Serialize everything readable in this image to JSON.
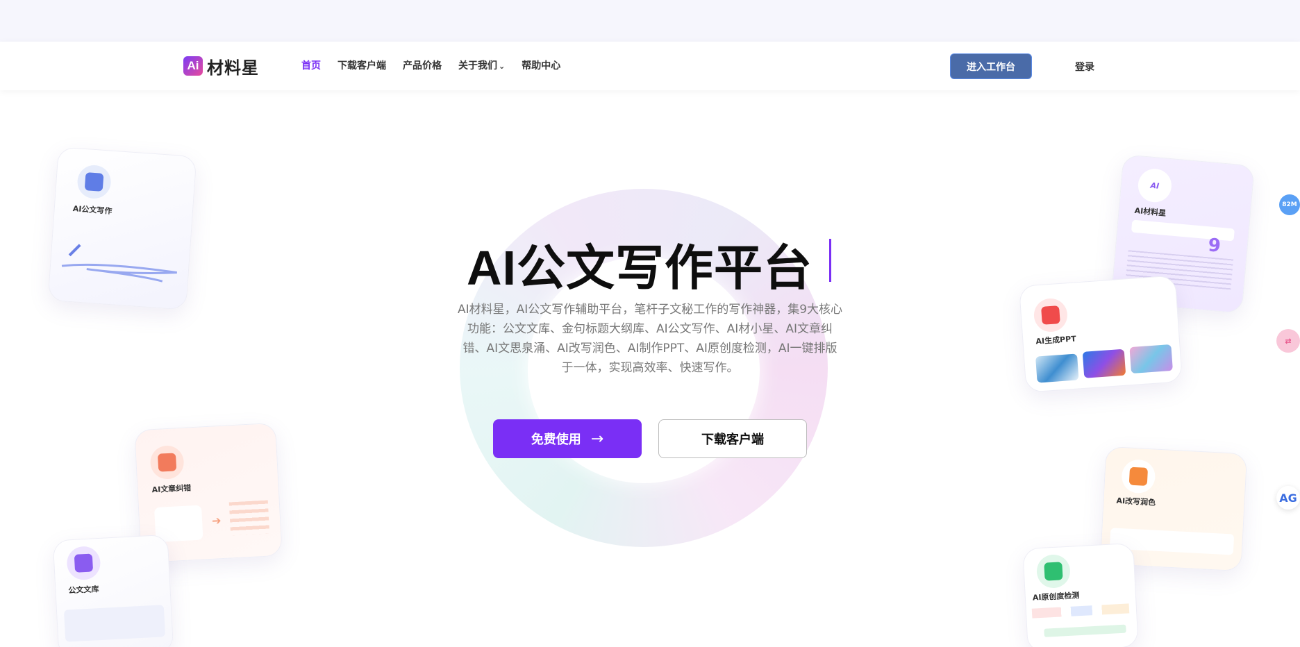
{
  "brand": {
    "logo_mark": "Ai",
    "name": "材料星"
  },
  "nav": {
    "items": [
      {
        "label": "首页",
        "active": true
      },
      {
        "label": "下载客户端"
      },
      {
        "label": "产品价格"
      },
      {
        "label": "关于我们",
        "has_dropdown": true
      },
      {
        "label": "帮助中心"
      }
    ],
    "workspace_button": "进入工作台",
    "login": "登录"
  },
  "hero": {
    "title": "AI公文写作平台",
    "description": "AI材料星，AI公文写作辅助平台，笔杆子文秘工作的写作神器，集9大核心功能：公文文库、金句标题大纲库、AI公文写作、AI材小星、AI文章纠错、AI文思泉涌、AI改写润色、AI制作PPT、AI原创度检测，AI一键排版于一体，实现高效率、快速写作。",
    "free_button": "免费使用",
    "free_button_icon": "arrow-right-icon",
    "download_button": "下载客户端"
  },
  "cards": {
    "doc_writing": "AI公文写作",
    "proofread": "AI文章纠错",
    "library": "公文文库",
    "assistant": "AI材料星",
    "ppt": "AI生成PPT",
    "rewrite": "AI改写润色",
    "originality": "AI原创度检测",
    "assistant_mark": "AI"
  },
  "side": {
    "badge_1": "82M",
    "badge_3": "AG"
  },
  "colors": {
    "accent": "#7a2ff5",
    "workspace_button": "#4a6ba8"
  }
}
